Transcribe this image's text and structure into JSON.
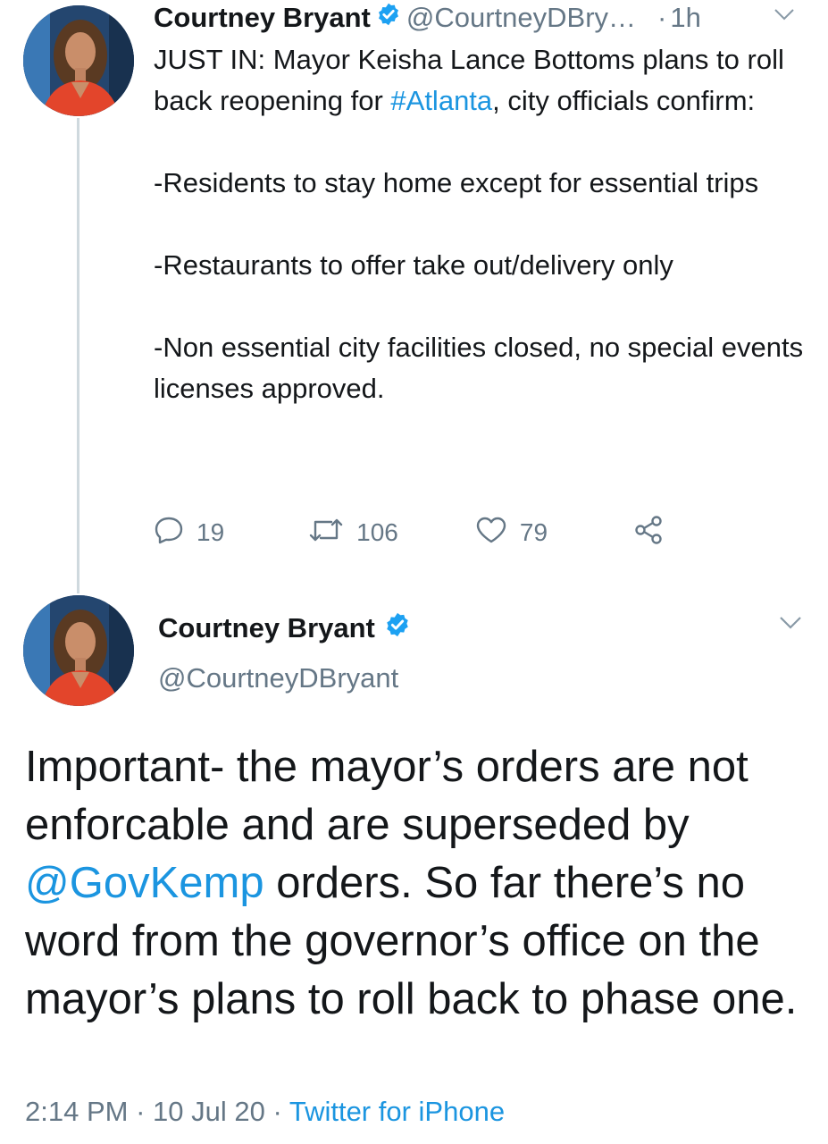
{
  "thread_tweet": {
    "author_name": "Courtney Bryant",
    "handle": "@CourtneyDBry…",
    "dot": "·",
    "time": "1h",
    "text_line1_before": "JUST IN: Mayor Keisha Lance Bottoms plans to roll back reopening for ",
    "hashtag": "#Atlanta",
    "text_line1_after": ", city officials confirm:",
    "bullet1": "-Residents to stay home except for essential trips",
    "bullet2": "-Restaurants to offer take out/delivery only",
    "bullet3": "-Non essential city facilities closed, no special events licenses approved.",
    "replies": "19",
    "retweets": "106",
    "likes": "79"
  },
  "main_tweet": {
    "author_name": "Courtney Bryant",
    "handle": "@CourtneyDBryant",
    "text_before": "Important- the mayor’s orders are not enforcable and are superseded by ",
    "mention": "@GovKemp",
    "text_after": " orders. So far there’s no word from the governor’s office on the mayor’s plans to roll back to phase one.",
    "time": "2:14 PM",
    "sep1": " · ",
    "date": "10 Jul 20",
    "sep2": " · ",
    "source": "Twitter for iPhone"
  },
  "icons": {
    "verified": "verified-badge-icon",
    "reply": "reply-icon",
    "retweet": "retweet-icon",
    "like": "heart-icon",
    "share": "share-icon",
    "more": "chevron-down-icon"
  },
  "colors": {
    "link": "#1b95e0",
    "secondary_text": "#657786",
    "verified": "#1da1f2"
  }
}
